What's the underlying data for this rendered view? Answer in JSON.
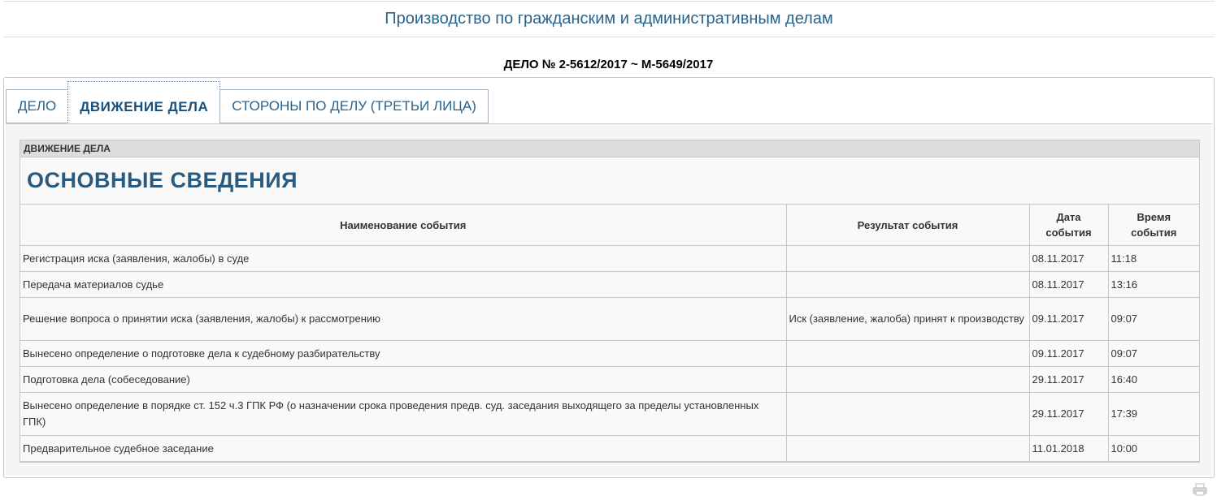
{
  "header": {
    "title": "Производство по гражданским и административным делам"
  },
  "case": {
    "number": "ДЕЛО № 2-5612/2017 ~ М-5649/2017"
  },
  "tabs": [
    {
      "label": "ДЕЛО"
    },
    {
      "label": "ДВИЖЕНИЕ ДЕЛА"
    },
    {
      "label": "СТОРОНЫ ПО ДЕЛУ (ТРЕТЬИ ЛИЦА)"
    }
  ],
  "active_tab": "ДВИЖЕНИЕ ДЕЛА",
  "section": {
    "bar_label": "ДВИЖЕНИЕ ДЕЛА",
    "heading": "ОСНОВНЫЕ СВЕДЕНИЯ"
  },
  "table": {
    "columns": [
      "Наименование события",
      "Результат события",
      "Дата события",
      "Время события"
    ],
    "rows": [
      {
        "event": "Регистрация иска (заявления, жалобы) в суде",
        "result": "",
        "date": "08.11.2017",
        "time": "11:18"
      },
      {
        "event": "Передача материалов судье",
        "result": "",
        "date": "08.11.2017",
        "time": "13:16"
      },
      {
        "event": "Решение вопроса о принятии иска (заявления, жалобы) к рассмотрению",
        "result": "Иск (заявление, жалоба) принят к производству",
        "date": "09.11.2017",
        "time": "09:07"
      },
      {
        "event": "Вынесено определение о подготовке дела к судебному разбирательству",
        "result": "",
        "date": "09.11.2017",
        "time": "09:07"
      },
      {
        "event": "Подготовка дела (собеседование)",
        "result": "",
        "date": "29.11.2017",
        "time": "16:40"
      },
      {
        "event": "Вынесено определение в порядке ст. 152 ч.3 ГПК РФ (о назначении срока проведения предв. суд. заседания выходящего за пределы установленных ГПК)",
        "result": "",
        "date": "29.11.2017",
        "time": "17:39"
      },
      {
        "event": "Предварительное судебное заседание",
        "result": "",
        "date": "11.01.2018",
        "time": "10:00"
      }
    ]
  },
  "colors": {
    "accent": "#29638c",
    "heading": "#2a5a7e",
    "border": "#c8c8c8"
  },
  "icons": {
    "print": "print-icon"
  }
}
